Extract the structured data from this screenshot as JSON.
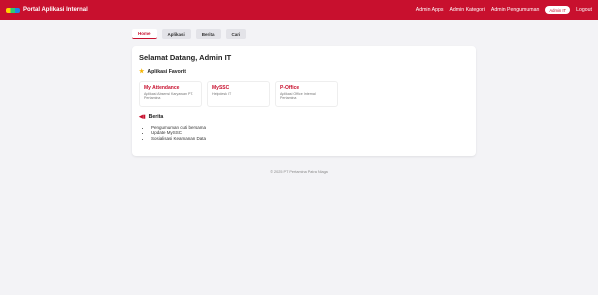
{
  "navbar": {
    "brand": "Portal Aplikasi Internal",
    "links": [
      "Admin Apps",
      "Admin Kategori",
      "Admin Pengumuman"
    ],
    "user": "Admin IT",
    "logout": "Logout"
  },
  "tabs": [
    "Home",
    "Aplikasi",
    "Berita",
    "Cari"
  ],
  "main": {
    "welcome": "Selamat Datang, Admin IT",
    "favorites_title": "Aplikasi Favorit",
    "favorites": [
      {
        "title": "My Attendance",
        "desc": "Aplikasi Absensi Karyawan PT. Pertamina"
      },
      {
        "title": "MySSC",
        "desc": "Helpdesk IT"
      },
      {
        "title": "P-Office",
        "desc": "Aplikasi Office Internal Pertamina"
      }
    ],
    "news_title": "Berita",
    "news": [
      "Pengumuman cuti bersama",
      "Update MySSC",
      "Sosialisasi Keamanan Data"
    ]
  },
  "footer": "© 2025 PT Pertamina Patra Niaga",
  "colors": {
    "primary": "#c8102e",
    "star": "#f5b400",
    "background": "#f3f3f6"
  }
}
